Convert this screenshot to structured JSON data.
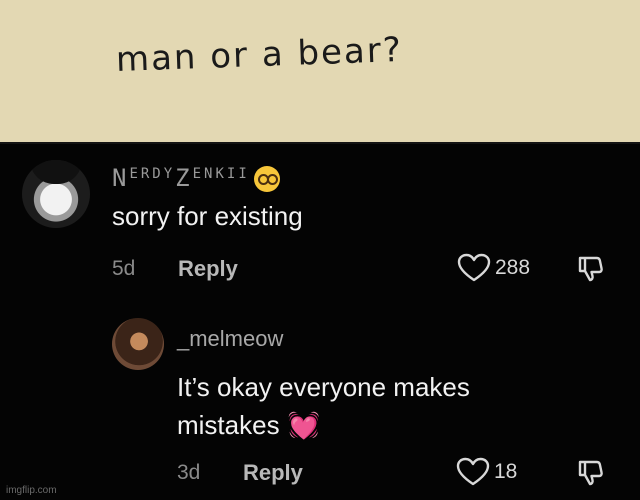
{
  "meme": {
    "handwritten_text": "man or a bear?"
  },
  "comments": [
    {
      "username_parts": [
        "N",
        "ERDY",
        "Z",
        "ENKII"
      ],
      "username_emoji": "nerd-face-icon",
      "text": "sorry for existing",
      "time": "5d",
      "reply_label": "Reply",
      "likes": "288"
    },
    {
      "username": "_melmeow",
      "text_line1": "It’s okay everyone makes",
      "text_line2": "mistakes",
      "text_emoji": "💓",
      "time": "3d",
      "reply_label": "Reply",
      "likes": "18"
    }
  ],
  "watermark": "imgflip.com",
  "colors": {
    "background": "#040404",
    "top_panel": "#e3d8b3",
    "text_primary": "#f2f2f2",
    "text_secondary": "#8a8a8a",
    "heart_emoji": "#ff3fa0"
  }
}
